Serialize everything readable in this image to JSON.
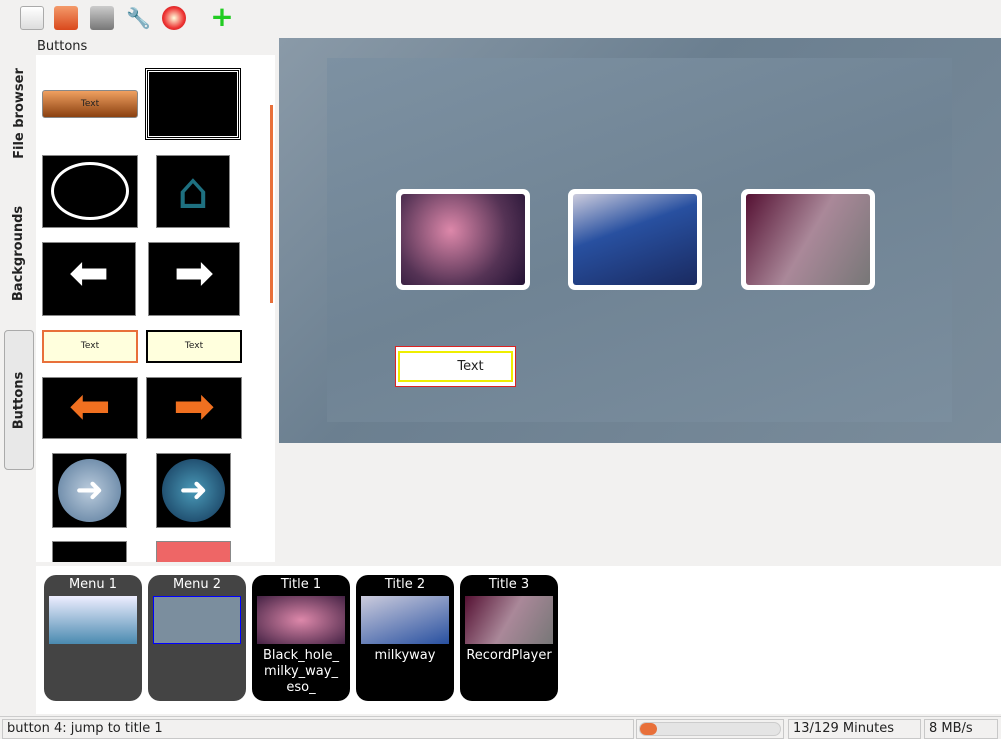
{
  "toolbar": {
    "items": [
      "new-icon",
      "open-icon",
      "save-icon",
      "settings-icon",
      "burn-icon",
      "add-icon"
    ]
  },
  "tabs": [
    {
      "label": "File browser"
    },
    {
      "label": "Backgrounds"
    },
    {
      "label": "Buttons"
    }
  ],
  "panel": {
    "title": "Buttons",
    "button_text": "Text"
  },
  "canvas": {
    "button_text": "Text"
  },
  "titleset": [
    {
      "title": "Menu 1",
      "label": ""
    },
    {
      "title": "Menu 2",
      "label": ""
    },
    {
      "title": "Title 1",
      "label": "Black_hole_ milky_way_ eso_"
    },
    {
      "title": "Title 2",
      "label": "milkyway"
    },
    {
      "title": "Title 3",
      "label": "RecordPlayer"
    }
  ],
  "status": {
    "message": "button 4: jump to title 1",
    "progress_percent": 10,
    "minutes": "13/129 Minutes",
    "speed": "8 MB/s"
  },
  "colors": {
    "accent": "#e8703a",
    "canvas": "#7a8c9b"
  }
}
